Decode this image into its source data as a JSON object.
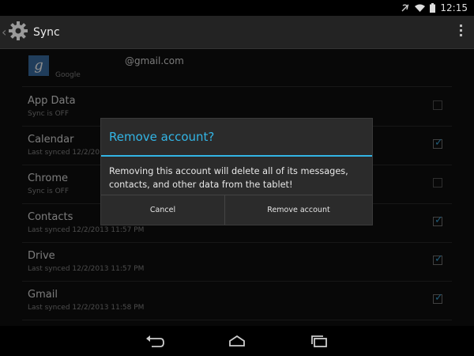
{
  "status": {
    "time": "12:15"
  },
  "action_bar": {
    "title": "Sync"
  },
  "account": {
    "email": "@gmail.com",
    "provider": "Google",
    "logo_letter": "g"
  },
  "sync_items": [
    {
      "name": "App Data",
      "status": "Sync is OFF",
      "checked": false
    },
    {
      "name": "Calendar",
      "status": "Last synced 12/2/2013",
      "checked": true
    },
    {
      "name": "Chrome",
      "status": "Sync is OFF",
      "checked": false
    },
    {
      "name": "Contacts",
      "status": "Last synced 12/2/2013 11:57 PM",
      "checked": true
    },
    {
      "name": "Drive",
      "status": "Last synced 12/2/2013 11:57 PM",
      "checked": true
    },
    {
      "name": "Gmail",
      "status": "Last synced 12/2/2013 11:58 PM",
      "checked": true
    }
  ],
  "dialog": {
    "title": "Remove account?",
    "message": "Removing this account will delete all of its messages, contacts, and other data from the tablet!",
    "cancel_label": "Cancel",
    "confirm_label": "Remove account"
  },
  "colors": {
    "accent": "#33b5e5",
    "background": "#101010"
  },
  "icons": {
    "status": [
      "silent-icon",
      "wifi-icon",
      "battery-icon"
    ],
    "action_bar": [
      "settings-gear-icon",
      "overflow-menu-icon"
    ],
    "nav": [
      "back-icon",
      "home-icon",
      "recents-icon"
    ]
  }
}
